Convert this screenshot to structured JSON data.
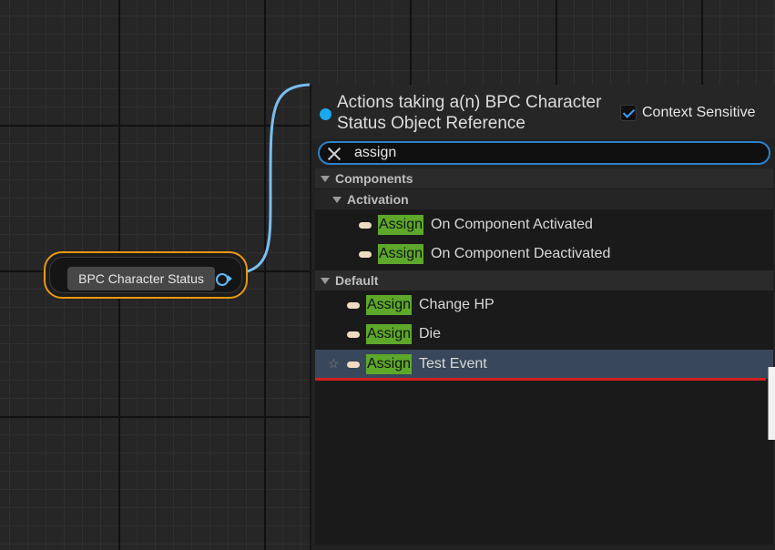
{
  "graph": {
    "node_label": "BPC Character Status"
  },
  "popup": {
    "title": "Actions taking a(n) BPC Character Status Object Reference",
    "context_sensitive_label": "Context Sensitive",
    "context_sensitive_checked": true,
    "search_value": "assign",
    "categories": [
      {
        "label": "Components"
      },
      {
        "label": "Activation"
      },
      {
        "label": "Default"
      }
    ],
    "items": [
      {
        "highlight": "Assign",
        "rest": "On Component Activated"
      },
      {
        "highlight": "Assign",
        "rest": "On Component Deactivated"
      },
      {
        "highlight": "Assign",
        "rest": "Change HP"
      },
      {
        "highlight": "Assign",
        "rest": "Die"
      },
      {
        "highlight": "Assign",
        "rest": "Test Event"
      }
    ],
    "selected_index": 4
  },
  "colors": {
    "node_border": "#e89a0e",
    "pin_blue": "#5fb8f0",
    "search_border": "#2c82c9",
    "match_highlight": "#5da82b",
    "selected_row": "#38475a",
    "selection_underline": "#d42020"
  },
  "icons": {
    "clear": "close-icon",
    "checkbox": "checkmark-icon",
    "category": "chevron-down-icon",
    "event": "event-pill-icon",
    "favorite": "star-icon"
  }
}
